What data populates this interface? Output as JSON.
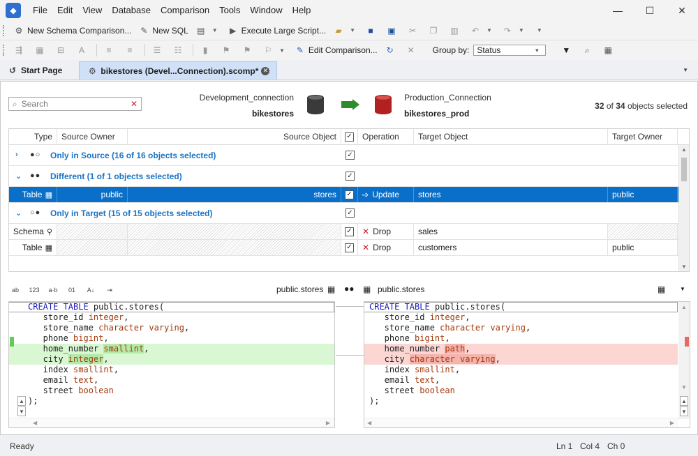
{
  "titlebar": {
    "menu": [
      "File",
      "Edit",
      "View",
      "Database",
      "Comparison",
      "Tools",
      "Window",
      "Help"
    ]
  },
  "toolbar1": {
    "new_schema_comparison": "New Schema Comparison...",
    "new_sql": "New SQL",
    "execute_large_script": "Execute Large Script..."
  },
  "toolbar2": {
    "edit_comparison": "Edit Comparison...",
    "group_by_label": "Group by:",
    "group_by_value": "Status"
  },
  "tabs": {
    "start_page": "Start Page",
    "active_doc": "bikestores (Devel...Connection).scomp*"
  },
  "comparison": {
    "source_connection": "Development_connection",
    "source_db": "bikestores",
    "target_connection": "Production_Connection",
    "target_db": "bikestores_prod",
    "selected_count": "32",
    "selected_of": "of",
    "total_count": "34",
    "selected_suffix": "objects selected",
    "colors": {
      "source": "#3a3a3a",
      "target": "#b32020",
      "arrow": "#2e8b2e"
    }
  },
  "search": {
    "placeholder": "Search"
  },
  "grid": {
    "columns": [
      "Type",
      "Source Owner",
      "Source Object",
      "Operation",
      "Target Object",
      "Target Owner"
    ],
    "group_only_source": "Only in Source (16 of 16 objects selected)",
    "group_different": "Different (1 of 1 objects selected)",
    "group_only_target": "Only in Target (15 of 15 objects selected)",
    "row_different": {
      "type": "Table",
      "source_owner": "public",
      "source_object": "stores",
      "operation": "Update",
      "target_object": "stores",
      "target_owner": "public"
    },
    "row_target_1": {
      "type": "Schema",
      "operation": "Drop",
      "target_object": "sales"
    },
    "row_target_2": {
      "type": "Table",
      "operation": "Drop",
      "target_object": "customers",
      "target_owner": "public"
    }
  },
  "diff": {
    "left_label": "public.stores",
    "right_label": "public.stores",
    "left": {
      "l1a": "CREATE TABLE",
      "l1b": " public.stores(",
      "l2a": "   store_id ",
      "l2b": "integer",
      "l3a": "   store_name ",
      "l3b": "character varying",
      "l4a": "   phone ",
      "l4b": "bigint",
      "l5a": "   home_number ",
      "l5b": "smallint",
      "l6a": "   city ",
      "l6b": "integer",
      "l7a": "   index ",
      "l7b": "smallint",
      "l8a": "   email ",
      "l8b": "text",
      "l9a": "   street ",
      "l9b": "boolean",
      "l10": ");"
    },
    "right": {
      "l1a": "CREATE TABLE",
      "l1b": " public.stores(",
      "l2a": "   store_id ",
      "l2b": "integer",
      "l3a": "   store_name ",
      "l3b": "character varying",
      "l4a": "   phone ",
      "l4b": "bigint",
      "l5a": "   home_number ",
      "l5b": "path",
      "l6a": "   city ",
      "l6b": "character varying",
      "l7a": "   index ",
      "l7b": "smallint",
      "l8a": "   email ",
      "l8b": "text",
      "l9a": "   street ",
      "l9b": "boolean",
      "l10": ");"
    }
  },
  "statusbar": {
    "status": "Ready",
    "line": "Ln 1",
    "col": "Col 4",
    "ch": "Ch 0"
  }
}
